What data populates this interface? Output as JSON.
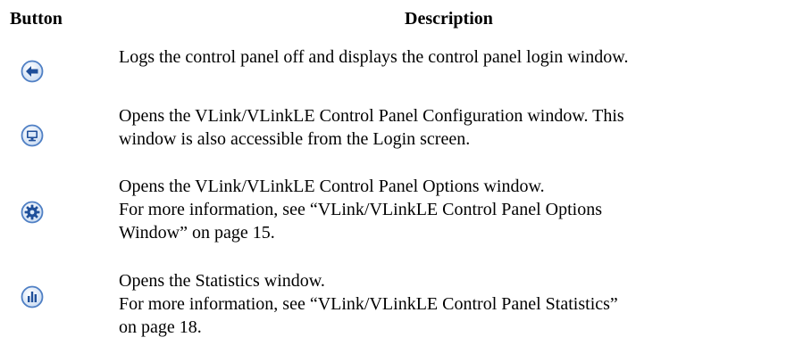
{
  "table": {
    "header": {
      "button": "Button",
      "description": "Description"
    },
    "rows": [
      {
        "icon": "back-arrow-icon",
        "lines": [
          "Logs the control panel off and displays the control panel login window."
        ]
      },
      {
        "icon": "monitor-icon",
        "lines": [
          "Opens the VLink/VLinkLE Control Panel Configuration window. This",
          "window is also accessible from the Login screen."
        ]
      },
      {
        "icon": "gear-icon",
        "lines": [
          "Opens the VLink/VLinkLE Control Panel Options window.",
          "For more information, see “VLink/VLinkLE Control Panel Options",
          "Window” on page 15."
        ]
      },
      {
        "icon": "bar-chart-icon",
        "lines": [
          "Opens the Statistics window.",
          "For more information, see “VLink/VLinkLE Control Panel Statistics”",
          "on page 18."
        ]
      }
    ]
  },
  "colors": {
    "icon_ring": "#4f7fc4",
    "icon_fill": "#dce9f8",
    "icon_glyph": "#1f4f9a"
  }
}
